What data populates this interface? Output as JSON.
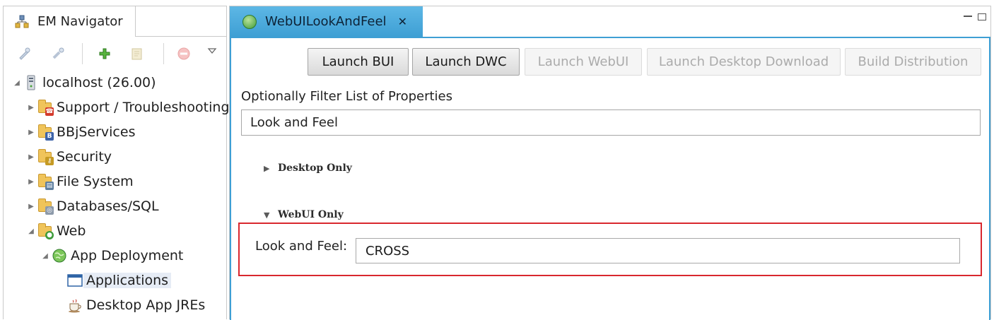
{
  "navigator": {
    "tab_label": "EM Navigator",
    "tree": [
      {
        "label": "localhost (26.00)",
        "icon": "server-icon"
      },
      {
        "label": "Support / Troubleshooting",
        "icon": "folder-support-icon"
      },
      {
        "label": "BBjServices",
        "icon": "folder-bbj-icon"
      },
      {
        "label": "Security",
        "icon": "folder-key-icon"
      },
      {
        "label": "File System",
        "icon": "folder-disk-icon"
      },
      {
        "label": "Databases/SQL",
        "icon": "folder-database-icon"
      },
      {
        "label": "Web",
        "icon": "folder-web-icon"
      },
      {
        "label": "App Deployment",
        "icon": "globe-icon"
      },
      {
        "label": "Applications",
        "icon": "window-icon",
        "selected": true
      },
      {
        "label": "Desktop App JREs",
        "icon": "coffee-cup-icon"
      }
    ]
  },
  "editor": {
    "tab_label": "WebUILookAndFeel",
    "buttons": [
      {
        "label": "Launch BUI",
        "enabled": true
      },
      {
        "label": "Launch DWC",
        "enabled": true
      },
      {
        "label": "Launch WebUI",
        "enabled": false
      },
      {
        "label": "Launch Desktop Download",
        "enabled": false
      },
      {
        "label": "Build Distribution",
        "enabled": false
      }
    ],
    "filter_label": "Optionally Filter List of Properties",
    "filter_value": "Look and Feel",
    "sections": [
      {
        "title": "Desktop Only",
        "expanded": false
      },
      {
        "title": "WebUI Only",
        "expanded": true
      }
    ],
    "property": {
      "label": "Look and Feel:",
      "value": "CROSS"
    }
  },
  "colors": {
    "active_tab": "#3e9fd4",
    "highlight_border": "#d9272e",
    "selected_row": "#e6ecf5"
  }
}
